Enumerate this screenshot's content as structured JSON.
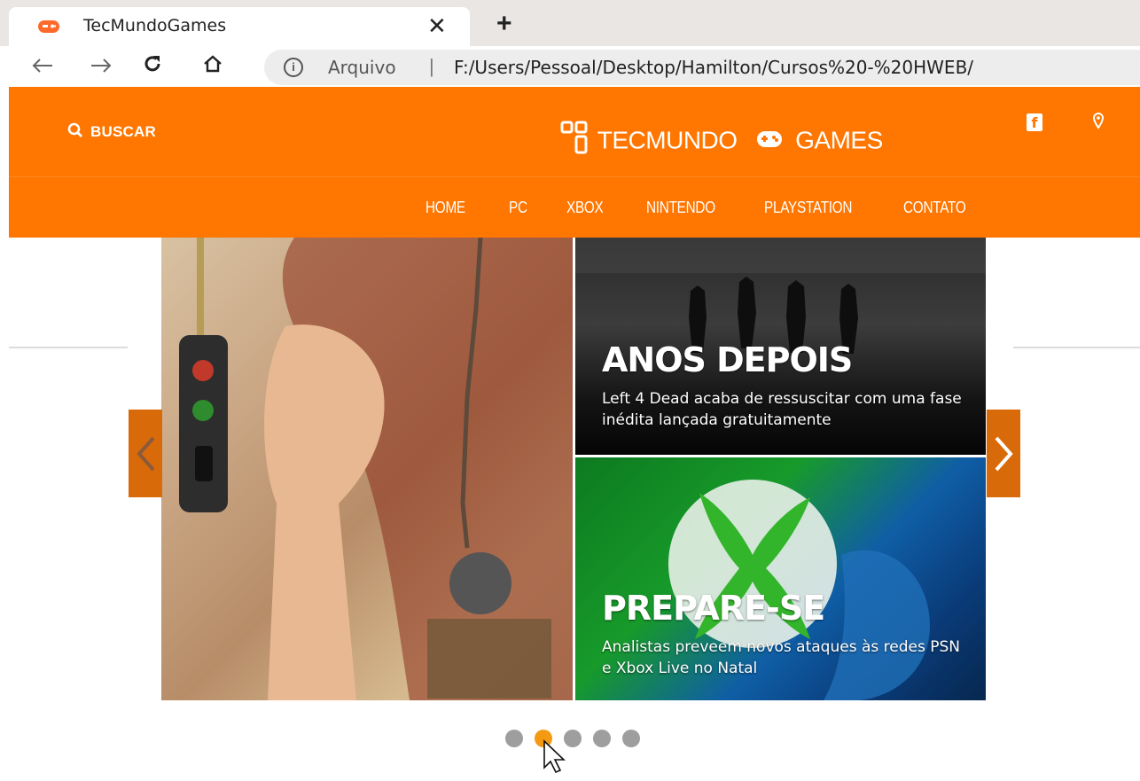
{
  "browser": {
    "tab_title": "TecMundoGames",
    "tab_close": "✕",
    "new_tab": "+",
    "address_label": "Arquivo",
    "address_sep": "|",
    "address_url": "F:/Users/Pessoal/Desktop/Hamilton/Cursos%20-%20HWEB/"
  },
  "header": {
    "search_label": "BUSCAR",
    "logo_part1": "TECMUNDO",
    "logo_part2": "GAMES",
    "facebook_letter": "f"
  },
  "nav": {
    "items": [
      "HOME",
      "PC",
      "XBOX",
      "NINTENDO",
      "PLAYSTATION",
      "CONTATO"
    ]
  },
  "slides": {
    "top": {
      "title": "ANOS DEPOIS",
      "text": "Left 4 Dead acaba de ressuscitar com uma fase inédita lançada gratuitamente"
    },
    "bottom": {
      "title": "PREPARE-SE",
      "text": "Analistas preveem novos ataques às redes PSN e Xbox Live no Natal"
    }
  },
  "carousel": {
    "dot_count": 5,
    "active_index": 1
  },
  "colors": {
    "brand": "#ff7600",
    "arrow": "#d96a0a",
    "dot_active": "#f39a12",
    "dot": "#9e9e9e"
  }
}
